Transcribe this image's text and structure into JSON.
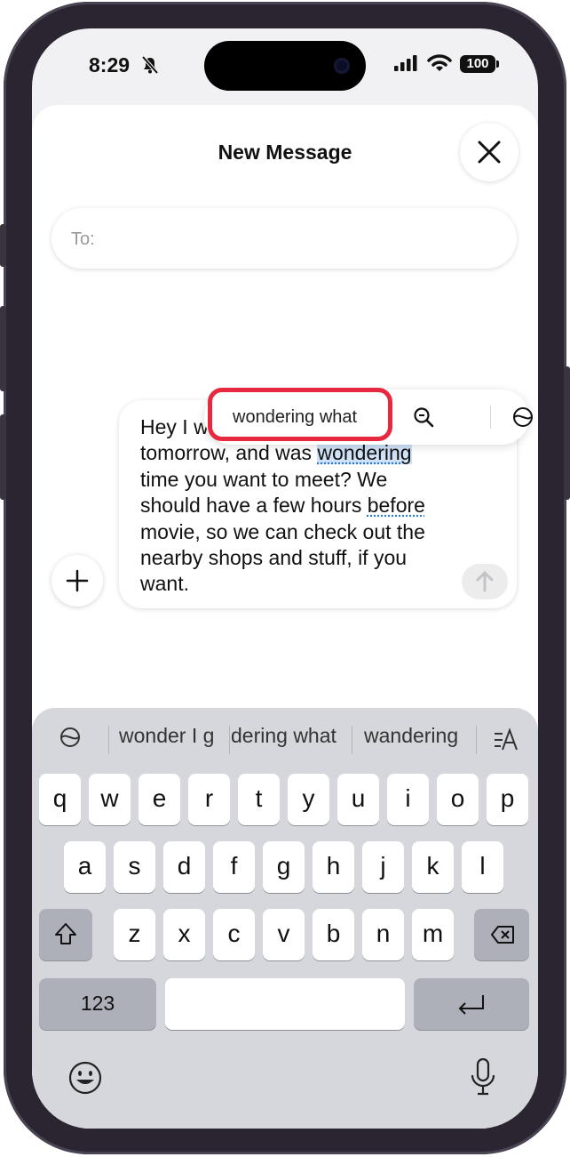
{
  "status_bar": {
    "time": "8:29",
    "battery": "100"
  },
  "header": {
    "title": "New Message"
  },
  "to_field": {
    "label": "To:"
  },
  "suggestion_popup": {
    "text": "wondering what",
    "highlight_color": "#e8283f"
  },
  "message": {
    "lines": [
      "Hey I was just thinking about",
      "tomorrow, and was ",
      "time you want to meet? We",
      "should have a few hours ",
      "movie, so we can check out the",
      "nearby shops and stuff, if you",
      "want."
    ],
    "selected_word": "wondering",
    "underlined_word": "before"
  },
  "keyboard": {
    "predictions": [
      "wonder I g",
      "dering what",
      "wandering"
    ],
    "rows": [
      [
        "q",
        "w",
        "e",
        "r",
        "t",
        "y",
        "u",
        "i",
        "o",
        "p"
      ],
      [
        "a",
        "s",
        "d",
        "f",
        "g",
        "h",
        "j",
        "k",
        "l"
      ],
      [
        "z",
        "x",
        "c",
        "v",
        "b",
        "n",
        "m"
      ]
    ],
    "numbers_key": "123"
  }
}
